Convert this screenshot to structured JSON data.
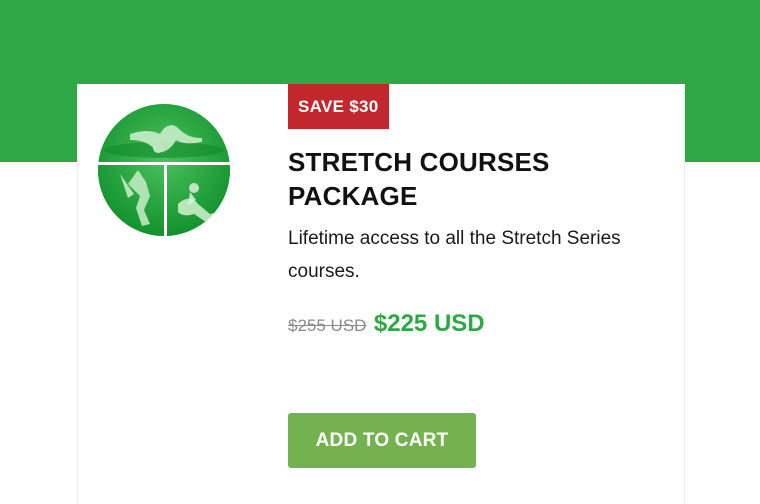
{
  "product": {
    "badge": "SAVE $30",
    "title": "STRETCH COURSES PACKAGE",
    "description": "Lifetime access to all the Stretch Series courses.",
    "price_original": "$255 USD",
    "price_sale": "$225 USD",
    "cta_label": "ADD TO CART",
    "image_icon": "stretch-poses-collage"
  },
  "colors": {
    "brand_green": "#2ea844",
    "badge_red": "#c1272d",
    "button_green": "#74b14f",
    "price_strike": "#8a8a8a"
  }
}
